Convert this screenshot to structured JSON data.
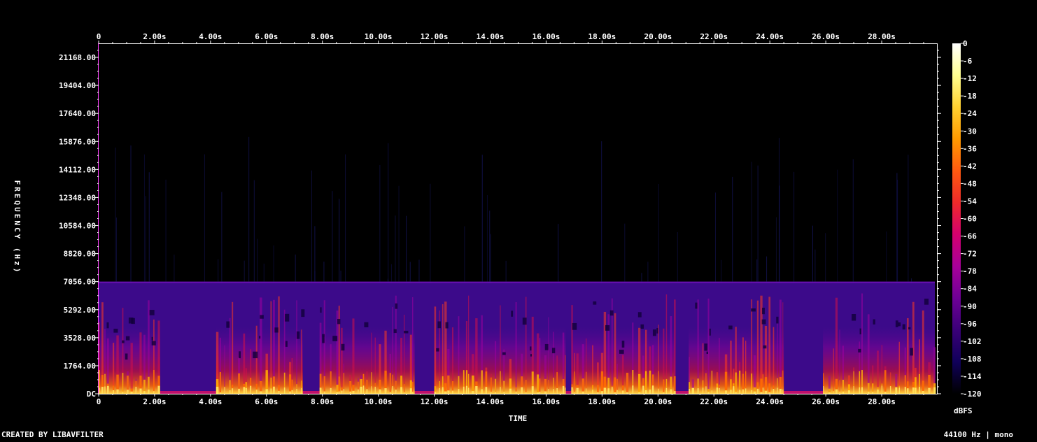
{
  "chart_data": {
    "type": "heatmap",
    "x_axis": {
      "tick_labels": [
        "0",
        "2.00s",
        "4.00s",
        "6.00s",
        "8.00s",
        "10.00s",
        "12.00s",
        "14.00s",
        "16.00s",
        "18.00s",
        "20.00s",
        "22.00s",
        "24.00s",
        "26.00s",
        "28.00s"
      ],
      "range": [
        0,
        30
      ],
      "label": "TIME"
    },
    "y_axis": {
      "tick_labels": [
        "DC",
        "1764.00",
        "3528.00",
        "5292.00",
        "7056.00",
        "8820.00",
        "10584.00",
        "12348.00",
        "14112.00",
        "15876.00",
        "17640.00",
        "19404.00",
        "21168.00"
      ],
      "range": [
        0,
        22050
      ],
      "label": "FREQUENCY (Hz)"
    },
    "colorbar": {
      "tick_labels": [
        "0",
        "-6",
        "-12",
        "-18",
        "-24",
        "-30",
        "-36",
        "-42",
        "-48",
        "-54",
        "-60",
        "-66",
        "-72",
        "-78",
        "-84",
        "-90",
        "-96",
        "-102",
        "-108",
        "-114",
        "-120"
      ],
      "range": [
        -120,
        0
      ],
      "unit": "dBFS",
      "colors": [
        "#000000",
        "#10005a",
        "#3a0078",
        "#6e0096",
        "#a8009a",
        "#d4006e",
        "#ee2a2a",
        "#ff5a10",
        "#ff9a00",
        "#ffd030",
        "#ffff90",
        "#ffffff"
      ]
    },
    "content_cutoff_hz": 7056,
    "speech_segments_s": [
      [
        0.0,
        2.2
      ],
      [
        4.2,
        7.3
      ],
      [
        7.9,
        11.3
      ],
      [
        12.0,
        16.7
      ],
      [
        16.9,
        20.6
      ],
      [
        21.1,
        24.5
      ],
      [
        25.9,
        29.9
      ]
    ],
    "duration_s": 29.9
  },
  "footer": {
    "credit": "CREATED BY LIBAVFILTER",
    "format": "44100 Hz | mono"
  }
}
